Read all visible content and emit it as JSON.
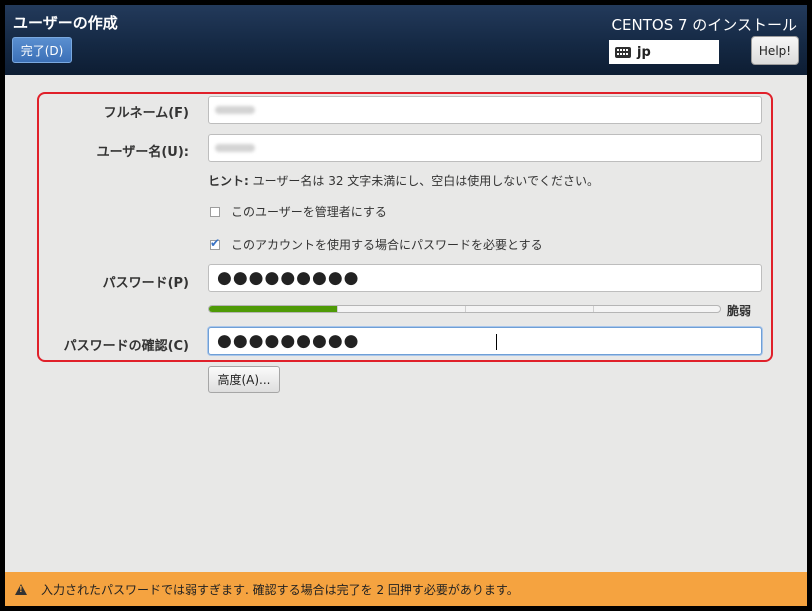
{
  "header": {
    "page_title": "ユーザーの作成",
    "done_button": "完了(D)",
    "install_title": "CENTOS 7 のインストール",
    "keyboard_layout": "jp",
    "help_button": "Help!"
  },
  "form": {
    "fullname_label": "フルネーム(F)",
    "fullname_value": "",
    "username_label": "ユーザー名(U):",
    "username_value": "",
    "hint_prefix": "ヒント:",
    "hint_text": "ユーザー名は 32 文字未満にし、空白は使用しないでください。",
    "admin_checkbox": {
      "label": "このユーザーを管理者にする",
      "checked": false
    },
    "require_password_checkbox": {
      "label": "このアカウントを使用する場合にパスワードを必要とする",
      "checked": true
    },
    "password_label": "パスワード(P)",
    "password_value": "●●●●●●●●●",
    "strength_level": 0.25,
    "strength_label": "脆弱",
    "confirm_label": "パスワードの確認(C)",
    "confirm_value": "●●●●●●●●●",
    "advanced_button": "高度(A)..."
  },
  "warning": {
    "text": "入力されたパスワードでは弱すぎます. 確認する場合は完了を 2 回押す必要があります。"
  },
  "colors": {
    "header": "#152944",
    "accent": "#3b70b7",
    "highlight_border": "#e0202a",
    "strength_fill": "#4e9a06",
    "warning_bar": "#f5a340"
  }
}
